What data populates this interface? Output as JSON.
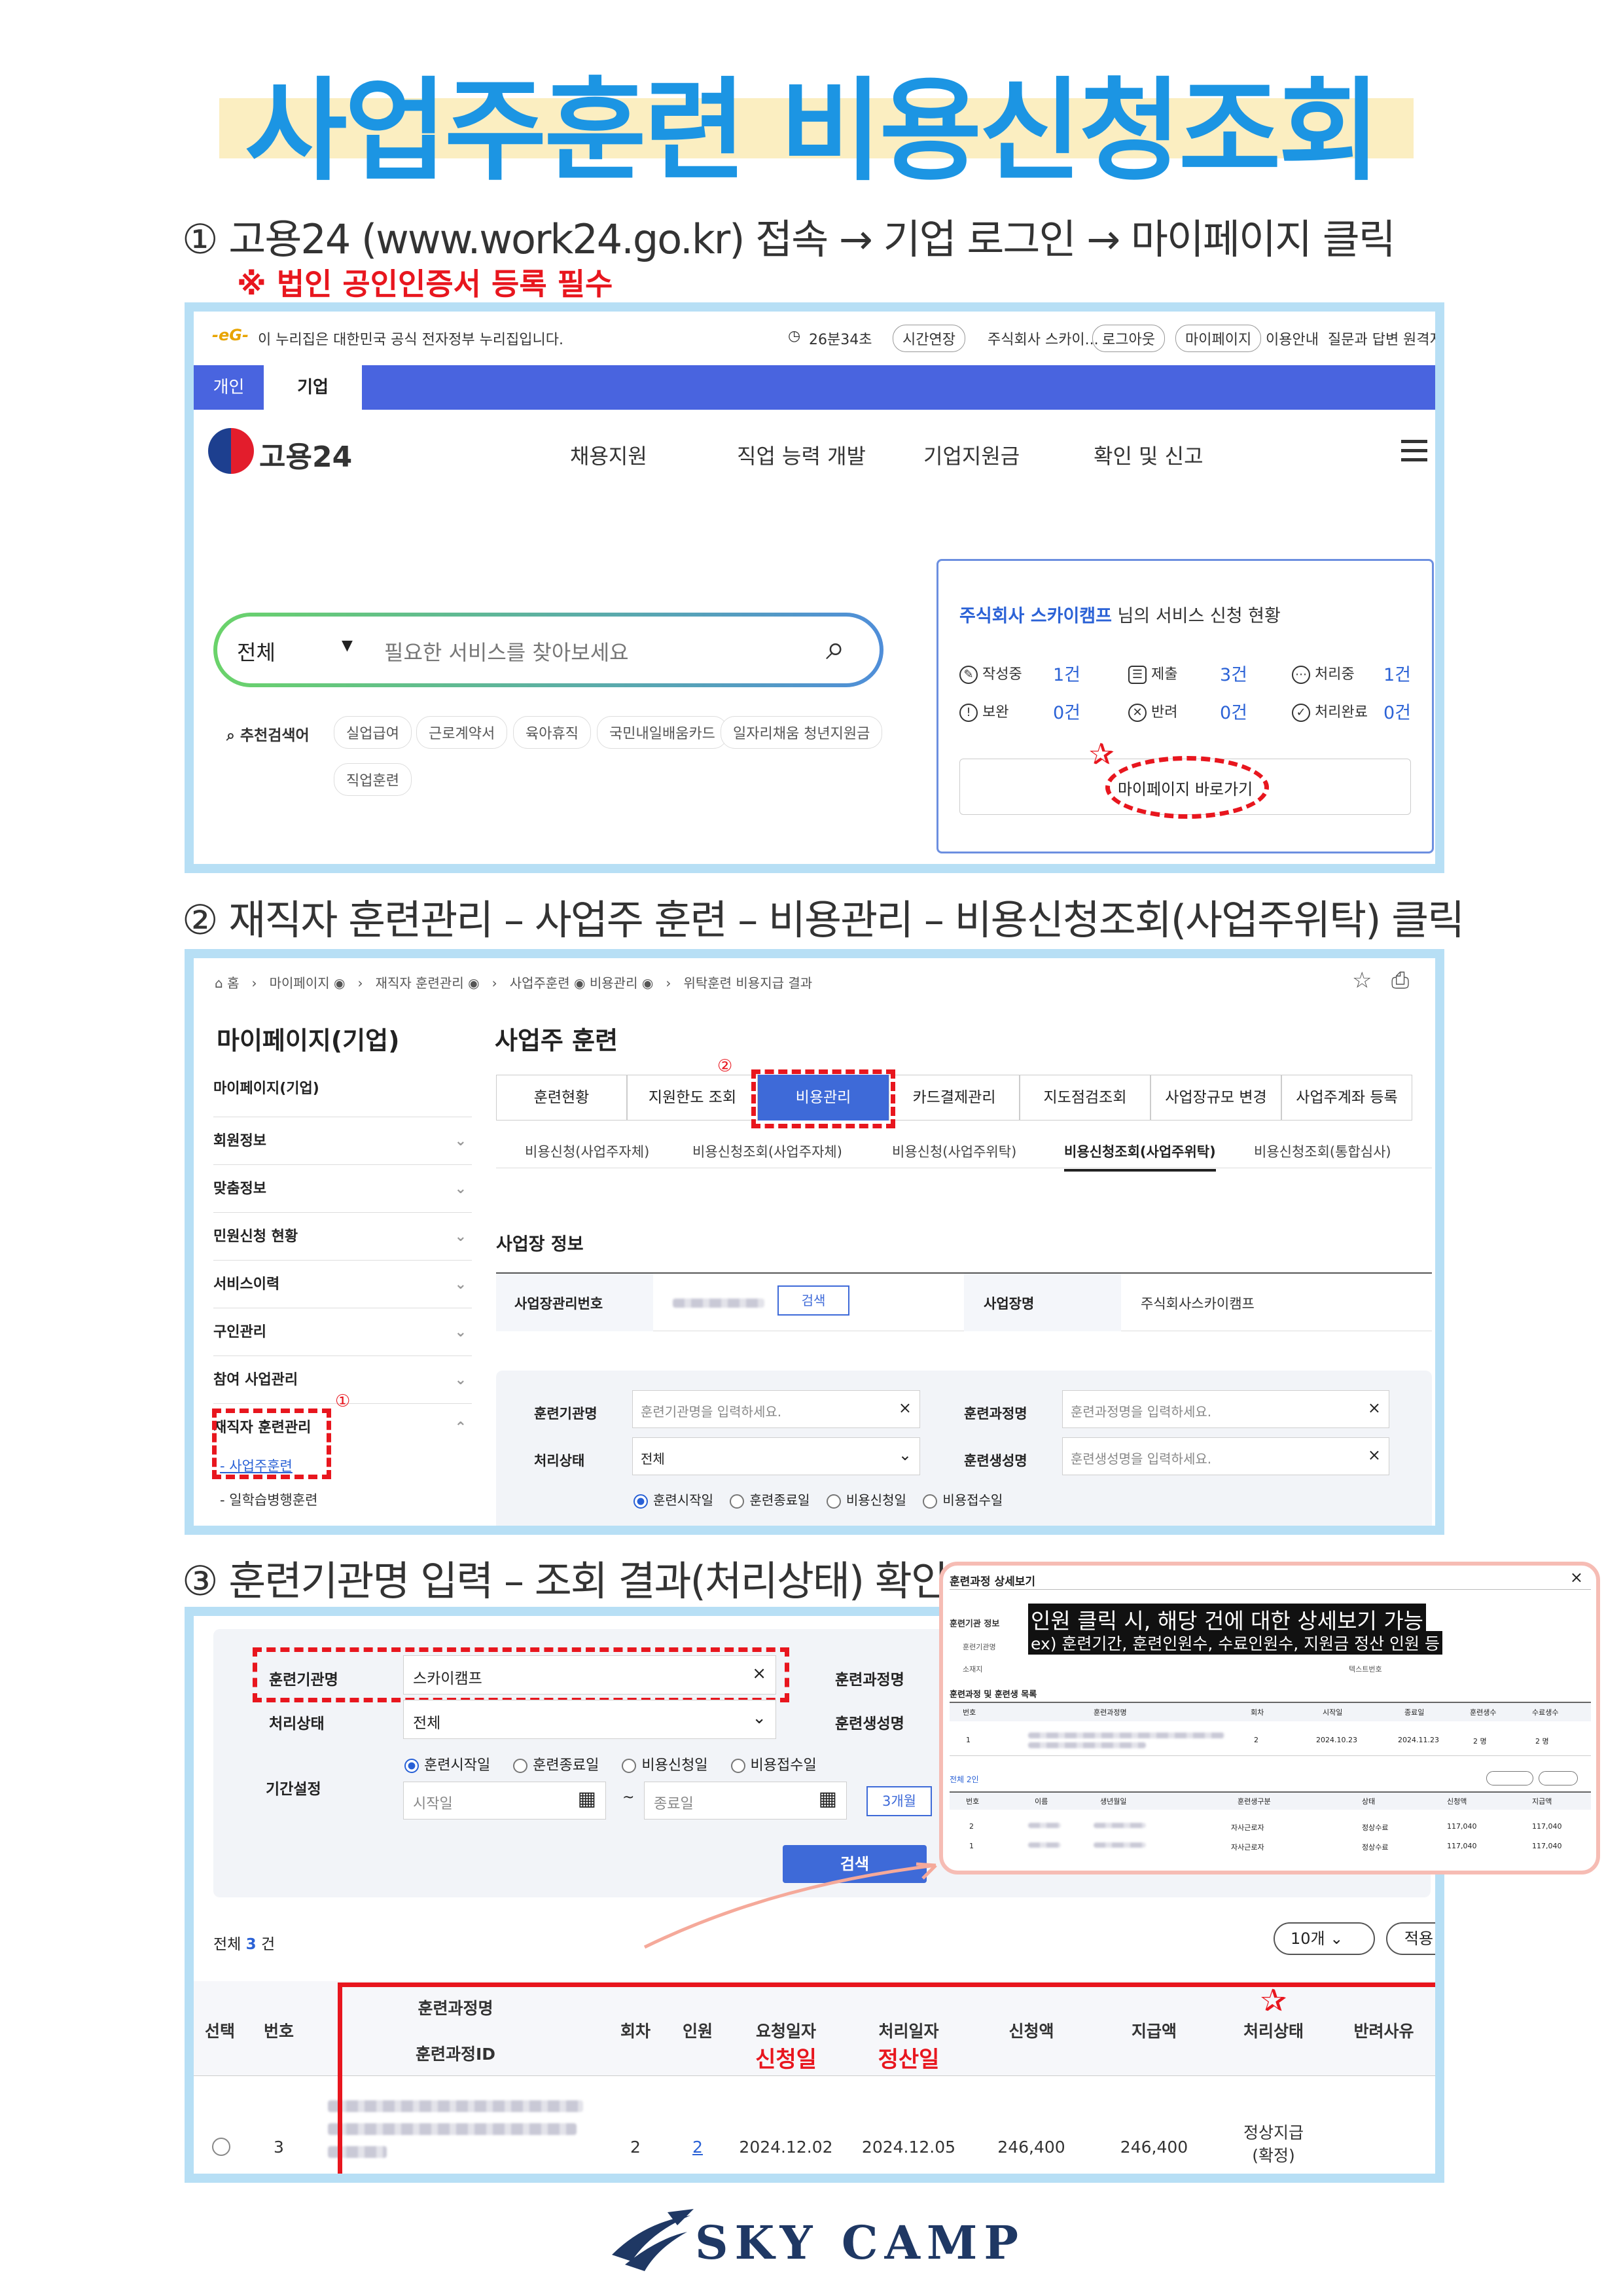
{
  "title": "사업주훈련 비용신청조회",
  "step1": {
    "text": "① 고용24 (www.work24.go.kr) 접속 → 기업 로그인 → 마이페이지 클릭",
    "note": "※ 법인 공인인증서 등록 필수"
  },
  "step2": {
    "text": "② 재직자 훈련관리 – 사업주 훈련 – 비용관리 – 비용신청조회(사업주위탁) 클릭"
  },
  "step3": {
    "text": "③ 훈련기관명 입력 – 조회 결과(처리상태) 확인"
  },
  "s1": {
    "gov_notice": "이 누리집은 대한민국 공식 전자정부 누리집입니다.",
    "timer": "26분34초",
    "extend": "시간연장",
    "company": "주식회사 스카이...",
    "logout": "로그아웃",
    "mypage": "마이페이지",
    "util": [
      "이용안내",
      "질문과 답변",
      "원격지원"
    ],
    "tab_personal": "개인",
    "tab_company": "기업",
    "logo": "고용24",
    "nav": [
      "채용지원",
      "직업 능력 개발",
      "기업지원금",
      "확인 및 신고"
    ],
    "search_select": "전체",
    "search_placeholder": "필요한 서비스를 찾아보세요",
    "recommend_label": "추천검색어",
    "keywords": [
      "실업급여",
      "근로계약서",
      "육아휴직",
      "국민내일배움카드",
      "일자리채움 청년지원금",
      "직업훈련"
    ],
    "status_company": "주식회사 스카이캠프",
    "status_suffix": " 님의 서비스 신청 현황",
    "status": [
      {
        "label": "작성중",
        "value": "1건",
        "icon": "pencil-icon"
      },
      {
        "label": "제출",
        "value": "3건",
        "icon": "list-icon"
      },
      {
        "label": "처리중",
        "value": "1건",
        "icon": "dots-icon"
      },
      {
        "label": "보완",
        "value": "0건",
        "icon": "exclaim-icon"
      },
      {
        "label": "반려",
        "value": "0건",
        "icon": "x-circle-icon"
      },
      {
        "label": "처리완료",
        "value": "0건",
        "icon": "check-icon"
      }
    ],
    "mypage_btn": "마이페이지 바로가기"
  },
  "s2": {
    "breadcrumb": [
      "홈",
      "마이페이지",
      "재직자 훈련관리",
      "사업주훈련",
      "비용관리",
      "위탁훈련 비용지급 결과"
    ],
    "side_title": "마이페이지(기업)",
    "side_items": [
      "마이페이지(기업)",
      "회원정보",
      "맞춤정보",
      "민원신청 현황",
      "서비스이력",
      "구인관리",
      "참여 사업관리",
      "재직자 훈련관리"
    ],
    "side_sub": [
      "- 사업주훈련",
      "- 일학습병행훈련"
    ],
    "main_title": "사업주 훈련",
    "tabs": [
      "훈련현황",
      "지원한도 조회",
      "비용관리",
      "카드결제관리",
      "지도점검조회",
      "사업장규모 변경",
      "사업주계좌 등록"
    ],
    "subtabs": [
      "비용신청(사업주자체)",
      "비용신청조회(사업주자체)",
      "비용신청(사업주위탁)",
      "비용신청조회(사업주위탁)",
      "비용신청조회(통합심사)"
    ],
    "section": "사업장 정보",
    "biz_no_label": "사업장관리번호",
    "search_btn": "검색",
    "biz_name_label": "사업장명",
    "biz_name": "주식회사스카이캠프",
    "org_label": "훈련기관명",
    "org_ph": "훈련기관명을 입력하세요.",
    "course_label": "훈련과정명",
    "course_ph": "훈련과정명을 입력하세요.",
    "state_label": "처리상태",
    "state_val": "전체",
    "trainee_label": "훈련생성명",
    "trainee_ph": "훈련생성명을 입력하세요.",
    "radios": [
      "훈련시작일",
      "훈련종료일",
      "비용신청일",
      "비용접수일"
    ],
    "marker1": "①",
    "marker2": "②"
  },
  "s3": {
    "org_label": "훈련기관명",
    "org_val": "스카이캠프",
    "course_label": "훈련과정명",
    "state_label": "처리상태",
    "state_val": "전체",
    "trainee_label": "훈련생성명",
    "period_label": "기간설정",
    "radios": [
      "훈련시작일",
      "훈련종료일",
      "비용신청일",
      "비용접수일"
    ],
    "start_ph": "시작일",
    "tilde": "~",
    "end_ph": "종료일",
    "months": "3개월",
    "search_btn": "검색",
    "total_prefix": "전체 ",
    "total_count": "3",
    "total_suffix": " 건",
    "page_size": "10개",
    "apply": "적용",
    "headers": {
      "select": "선택",
      "no": "번호",
      "course": "훈련과정명",
      "course_id": "훈련과정ID",
      "round": "회차",
      "people": "인원",
      "req_date": "요청일자",
      "proc_date": "처리일자",
      "req_amt": "신청액",
      "pay_amt": "지급액",
      "state": "처리상태",
      "reject": "반려사유"
    },
    "hint_req": "신청일",
    "hint_proc": "정산일",
    "row": {
      "no": "3",
      "round": "2",
      "people": "2",
      "req_date": "2024.12.02",
      "proc_date": "2024.12.05",
      "req_amt": "246,400",
      "pay_amt": "246,400",
      "state1": "정상지급",
      "state2": "(확정)"
    }
  },
  "popup": {
    "title": "훈련과정 상세보기",
    "close": "×",
    "note1": "인원 클릭 시, 해당 건에 대한 상세보기 가능",
    "note2": "ex) 훈련기간, 훈련인원수, 수료인원수, 지원금 정산 인원 등",
    "labels": [
      "훈련기관 정보",
      "훈련기관명",
      "소재지",
      "텍스트번호"
    ],
    "sub_title": "훈련과정 및 훈련생 목록",
    "t1_headers": [
      "번호",
      "훈련과정명",
      "회차",
      "시작일",
      "종료일",
      "훈련생수",
      "수료생수"
    ],
    "t1_row": [
      "1",
      "2",
      "2024.10.23",
      "2024.11.23",
      "2 명",
      "2 명"
    ],
    "total": "전체 2인",
    "t2_headers": [
      "번호",
      "이름",
      "생년월일",
      "훈련생구분",
      "상태",
      "신청액",
      "지급액"
    ],
    "t2_rows": [
      [
        "2",
        "자사근로자",
        "정상수료",
        "117,040",
        "117,040"
      ],
      [
        "1",
        "자사근로자",
        "정상수료",
        "117,040",
        "117,040"
      ]
    ]
  },
  "footer": {
    "brand": "SKY CAMP"
  }
}
